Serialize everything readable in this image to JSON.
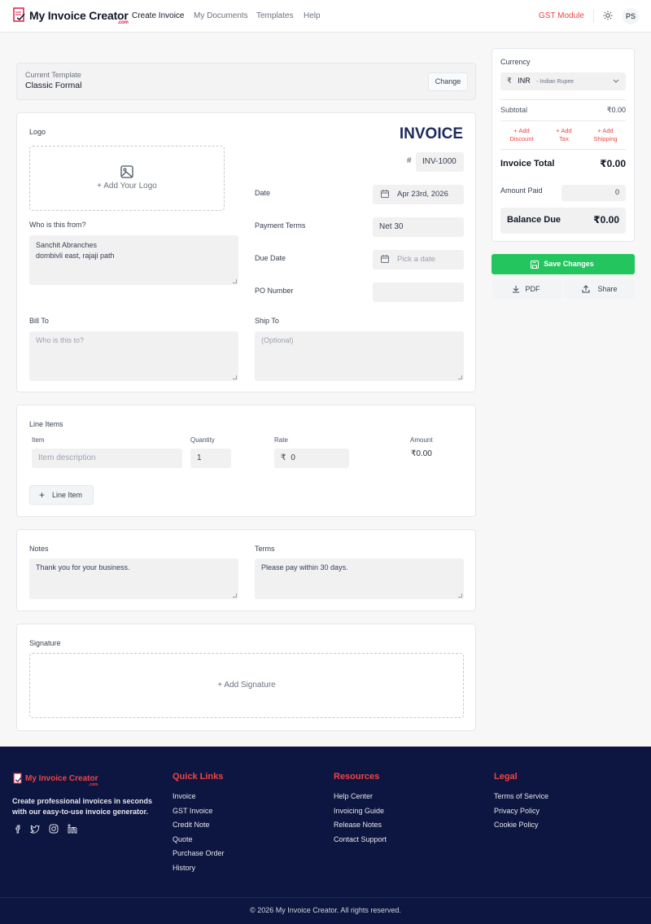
{
  "header": {
    "brand": "My Invoice Creator",
    "brand_sub": ".com",
    "nav": [
      "Create Invoice",
      "My Documents",
      "Templates",
      "Help"
    ],
    "gst_module": "GST Module",
    "avatar_initials": "PS"
  },
  "template": {
    "label": "Current Template",
    "name": "Classic Formal",
    "change_label": "Change"
  },
  "invoice": {
    "title": "INVOICE",
    "logo_label": "Logo",
    "add_logo": "+ Add Your Logo",
    "number_hash": "#",
    "number": "INV-1000",
    "from_label": "Who is this from?",
    "from_value_line1": "Sanchit Abranches",
    "from_value_line2": "dombivli east, rajaji path",
    "date_label": "Date",
    "date_value": "Apr 23rd, 2026",
    "payment_terms_label": "Payment Terms",
    "payment_terms_value": "Net 30",
    "due_date_label": "Due Date",
    "due_date_placeholder": "Pick a date",
    "po_label": "PO Number",
    "po_value": "",
    "bill_to_label": "Bill To",
    "bill_to_placeholder": "Who is this to?",
    "ship_to_label": "Ship To",
    "ship_to_placeholder": "(Optional)"
  },
  "line_items": {
    "title": "Line Items",
    "col_item": "Item",
    "col_quantity": "Quantity",
    "col_rate": "Rate",
    "col_amount": "Amount",
    "item_placeholder": "Item description",
    "quantity": "1",
    "rate_symbol": "₹",
    "rate": "0",
    "amount": "₹0.00",
    "add_line_item": "Line Item"
  },
  "notes": {
    "notes_label": "Notes",
    "notes_value": "Thank you for your business.",
    "terms_label": "Terms",
    "terms_value": "Please pay within 30 days."
  },
  "signature": {
    "label": "Signature",
    "add": "+ Add Signature"
  },
  "summary": {
    "currency_label": "Currency",
    "currency_symbol": "₹",
    "currency_code": "INR",
    "currency_name": "- Indian Rupee",
    "subtotal_label": "Subtotal",
    "subtotal_value": "₹0.00",
    "add_discount_1": "+ Add",
    "add_discount_2": "Discount",
    "add_tax_1": "+ Add",
    "add_tax_2": "Tax",
    "add_shipping_1": "+ Add",
    "add_shipping_2": "Shipping",
    "invoice_total_label": "Invoice Total",
    "invoice_total_value": "₹0.00",
    "amount_paid_label": "Amount Paid",
    "amount_paid_value": "0",
    "balance_due_label": "Balance Due",
    "balance_due_value": "₹0.00",
    "save_label": "Save Changes",
    "pdf_label": "PDF",
    "share_label": "Share"
  },
  "footer": {
    "brand": "My Invoice Creator",
    "brand_sub": ".com",
    "tagline_1": "Create professional invoices in seconds",
    "tagline_2": "with our easy-to-use invoice generator.",
    "quick_links_title": "Quick Links",
    "quick_links": [
      "Invoice",
      "GST Invoice",
      "Credit Note",
      "Quote",
      "Purchase Order",
      "History"
    ],
    "resources_title": "Resources",
    "resources": [
      "Help Center",
      "Invoicing Guide",
      "Release Notes",
      "Contact Support"
    ],
    "legal_title": "Legal",
    "legal": [
      "Terms of Service",
      "Privacy Policy",
      "Cookie Policy"
    ],
    "copyright": "© 2026 My Invoice Creator. All rights reserved."
  },
  "colors": {
    "accent_red": "#ef4444",
    "save_green": "#22c55e",
    "footer_navy": "#0d1640",
    "title_navy": "#1e2a5a"
  }
}
